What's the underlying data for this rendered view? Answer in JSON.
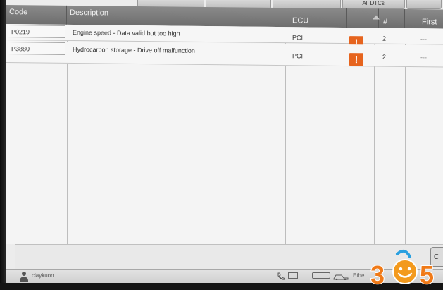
{
  "tabs": [
    "",
    "",
    "",
    "All DTCs",
    ""
  ],
  "table": {
    "headers": {
      "code": "Code",
      "description": "Description",
      "ecu": "ECU",
      "count": "#",
      "first": "First"
    },
    "rows": [
      {
        "code": "P0219",
        "description": "Engine speed - Data valid but too high",
        "ecu": "PCI",
        "count": "2",
        "first": "---"
      },
      {
        "code": "P3880",
        "description": "Hydrocarbon storage - Drive off malfunction",
        "ecu": "PCI",
        "count": "2",
        "first": "---"
      }
    ]
  },
  "status": {
    "username": "claykuon",
    "side_button": "C",
    "icons": [
      "phone-icon",
      "monitor-icon",
      "battery-icon",
      "vehicle-connection-icon",
      "ethernet-icon"
    ],
    "tray_text": "Ethe"
  },
  "watermark": {
    "text_left": "3",
    "text_right": "5"
  },
  "colors": {
    "header": "#7a7a7a",
    "warning": "#e6641e"
  }
}
